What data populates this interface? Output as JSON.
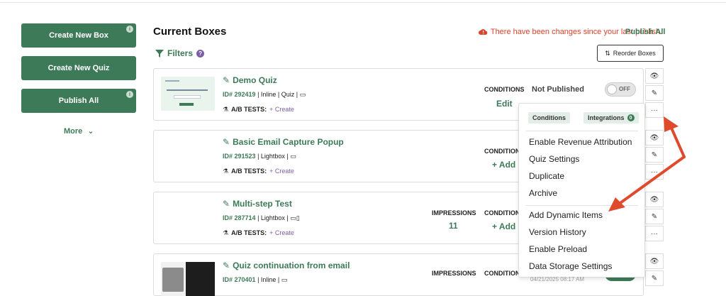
{
  "sidebar": {
    "buttons": [
      {
        "label": "Create New Box",
        "badge": "i"
      },
      {
        "label": "Create New Quiz"
      },
      {
        "label": "Publish All",
        "badge": "i"
      }
    ],
    "more_label": "More"
  },
  "header": {
    "title": "Current Boxes",
    "changes_text": "There have been changes since your last publish.",
    "publish_link": "Publish All",
    "filters_label": "Filters",
    "filters_help": "?",
    "reorder_label": "Reorder Boxes"
  },
  "boxes": [
    {
      "name": "Demo Quiz",
      "id": "ID# 292419",
      "meta": "| Inline | Quiz |",
      "ab_label": "A/B TESTS:",
      "ab_create": "+ Create",
      "conditions_label": "CONDITIONS",
      "conditions_value": "Edit",
      "status": "Not Published",
      "toggle": "OFF"
    },
    {
      "name": "Basic Email Capture Popup",
      "id": "ID# 291523",
      "meta": "| Lightbox |",
      "ab_label": "A/B TESTS:",
      "ab_create": "+ Create",
      "conditions_label": "CONDITION",
      "conditions_value": "+ Add"
    },
    {
      "name": "Multi-step Test",
      "id": "ID# 287714",
      "meta": "| Lightbox |",
      "ab_label": "A/B TESTS:",
      "ab_create": "+ Create",
      "impressions_label": "IMPRESSIONS",
      "impressions_value": "11",
      "conditions_label": "CONDITION",
      "conditions_value": "+ Add"
    },
    {
      "name": "Quiz continuation from email",
      "id": "ID# 270401",
      "meta": "| Inline |",
      "impressions_label": "IMPRESSIONS",
      "impressions_value": "",
      "conditions_label": "CONDITION",
      "date": "04/21/2025 08:17 AM",
      "toggle": "ON"
    }
  ],
  "menu": {
    "chip_conditions": "Conditions",
    "chip_integrations": "Integrations",
    "chip_integrations_count": "0",
    "items": [
      "Enable Revenue Attribution",
      "Quiz Settings",
      "Duplicate",
      "Archive",
      "Add Dynamic Items",
      "Version History",
      "Enable Preload",
      "Data Storage Settings"
    ]
  },
  "colors": {
    "brand_green": "#3d7a57",
    "alert_red": "#d9442c",
    "accent_purple": "#7b5ea7",
    "arrow_red": "#e04a2c"
  },
  "icons": [
    "info-icon",
    "chevron-down-icon",
    "cloud-alert-icon",
    "filter-icon",
    "help-icon",
    "sort-icon",
    "edit-icon",
    "device-icon",
    "flask-icon",
    "eye-icon",
    "pencil-icon",
    "more-icon"
  ]
}
